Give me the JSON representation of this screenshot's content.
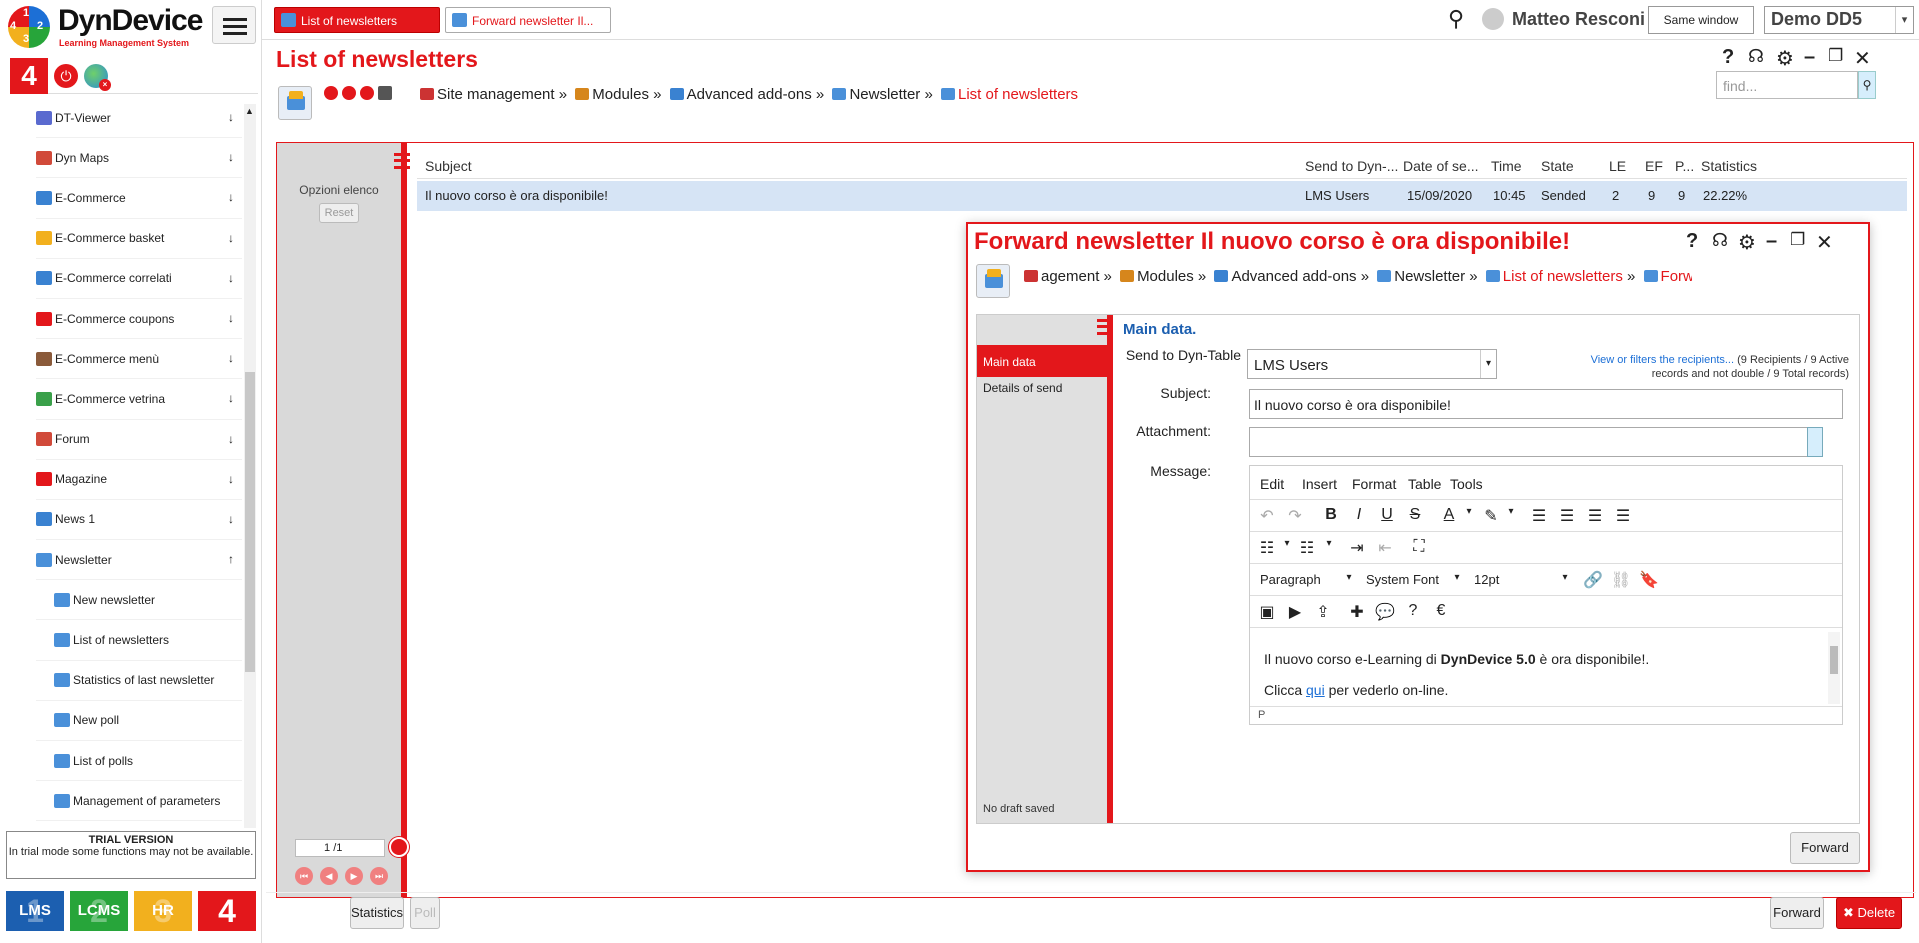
{
  "sidebar": {
    "logo": {
      "title": "DynDevice",
      "subtitle": "Learning Management System"
    },
    "toolbar": {
      "badge": "4"
    },
    "items": [
      {
        "label": "DT-Viewer",
        "color": "#5a6acf"
      },
      {
        "label": "Dyn Maps",
        "color": "#d14a3a"
      },
      {
        "label": "E-Commerce",
        "color": "#3a82d1"
      },
      {
        "label": "E-Commerce basket",
        "color": "#f2b01e"
      },
      {
        "label": "E-Commerce correlati",
        "color": "#3a82d1"
      },
      {
        "label": "E-Commerce coupons",
        "color": "#e3171b"
      },
      {
        "label": "E-Commerce menù",
        "color": "#8a5a3a"
      },
      {
        "label": "E-Commerce vetrina",
        "color": "#3aa04a"
      },
      {
        "label": "Forum",
        "color": "#d14a3a"
      },
      {
        "label": "Magazine",
        "color": "#e3171b"
      },
      {
        "label": "News 1",
        "color": "#3a82d1"
      },
      {
        "label": "Newsletter",
        "color": "#4a90d9"
      }
    ],
    "subitems": [
      {
        "label": "New newsletter"
      },
      {
        "label": "List of newsletters"
      },
      {
        "label": "Statistics of last newsletter"
      },
      {
        "label": "New poll"
      },
      {
        "label": "List of polls"
      },
      {
        "label": "Management of parameters"
      }
    ],
    "trial": {
      "title": "TRIAL VERSION",
      "text": "In trial mode some functions may not be available."
    },
    "modules": [
      {
        "label": "LMS",
        "num": "1",
        "color": "#1c5fb0"
      },
      {
        "label": "LCMS",
        "num": "2",
        "color": "#27a53a"
      },
      {
        "label": "HR",
        "num": "3",
        "color": "#f2b01e"
      },
      {
        "label": "",
        "num": "4",
        "color": "#e3171b"
      }
    ]
  },
  "topbar": {
    "tabs": [
      {
        "label": "List of newsletters"
      },
      {
        "label": "Forward newsletter Il..."
      }
    ],
    "user": "Matteo Resconi",
    "same_window": "Same window",
    "demo": "Demo DD5"
  },
  "main": {
    "title": "List of newsletters",
    "breadcrumb": [
      "Site management",
      "Modules",
      "Advanced add-ons",
      "Newsletter",
      "List of newsletters"
    ],
    "find_placeholder": "find...",
    "list_options": "Opzioni elenco",
    "reset": "Reset",
    "pager": {
      "page": "1",
      "total": "/1"
    },
    "columns": [
      "Subject",
      "Send to Dyn-...",
      "Date of se...",
      "Time",
      "State",
      "LE",
      "EF",
      "P...",
      "Statistics"
    ],
    "rows": [
      {
        "subject": "Il nuovo corso è ora disponibile!",
        "send_to": "LMS Users",
        "date": "15/09/2020",
        "time": "10:45",
        "state": "Sended",
        "le": "2",
        "ef": "9",
        "p": "9",
        "stats": "22.22%"
      }
    ]
  },
  "dialog": {
    "title": "Forward newsletter Il nuovo corso è ora disponibile!",
    "breadcrumb": [
      "agement",
      "Modules",
      "Advanced add-ons",
      "Newsletter",
      "List of newsletters",
      "Forward newsletter"
    ],
    "tabs": [
      "Main data",
      "Details of send"
    ],
    "draft": "No draft saved",
    "section": "Main data.",
    "labels": {
      "send_to": "Send to Dyn-Table",
      "subject": "Subject:",
      "attachment": "Attachment:",
      "message": "Message:"
    },
    "send_to_value": "LMS Users",
    "view_link": "View or filters the recipients...",
    "view_info_1": " (9 Recipients / 9 Active",
    "view_info_2": "records and not double / 9 Total records)",
    "subject_value": "Il nuovo corso è ora disponibile!",
    "editor": {
      "menu": [
        "Edit",
        "Insert",
        "Format",
        "Table",
        "Tools"
      ],
      "block": "Paragraph",
      "font": "System Font",
      "size": "12pt",
      "line1_pre": "Il nuovo corso e-Learning di ",
      "line1_bold": "DynDevice 5.0",
      "line1_post": " è ora disponibile!.",
      "line2_pre": "Clicca ",
      "line2_link": "qui",
      "line2_post": " per vederlo on-line.",
      "status": "P"
    },
    "forward": "Forward"
  },
  "bottom": {
    "statistics": "Statistics",
    "poll": "Poll",
    "forward": "Forward",
    "delete": "Delete"
  }
}
